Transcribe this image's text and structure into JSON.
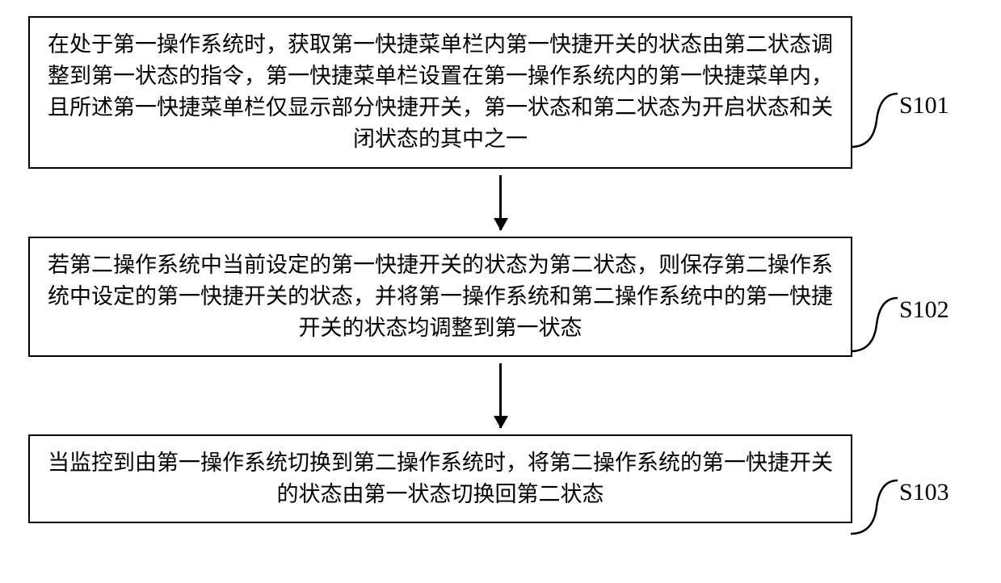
{
  "steps": [
    {
      "label": "S101",
      "text": "在处于第一操作系统时，获取第一快捷菜单栏内第一快捷开关的状态由第二状态调整到第一状态的指令，第一快捷菜单栏设置在第一操作系统内的第一快捷菜单内，且所述第一快捷菜单栏仅显示部分快捷开关，第一状态和第二状态为开启状态和关闭状态的其中之一"
    },
    {
      "label": "S102",
      "text": "若第二操作系统中当前设定的第一快捷开关的状态为第二状态，则保存第二操作系统中设定的第一快捷开关的状态，并将第一操作系统和第二操作系统中的第一快捷开关的状态均调整到第一状态"
    },
    {
      "label": "S103",
      "text": "当监控到由第一操作系统切换到第二操作系统时，将第二操作系统的第一快捷开关的状态由第一状态切换回第二状态"
    }
  ]
}
